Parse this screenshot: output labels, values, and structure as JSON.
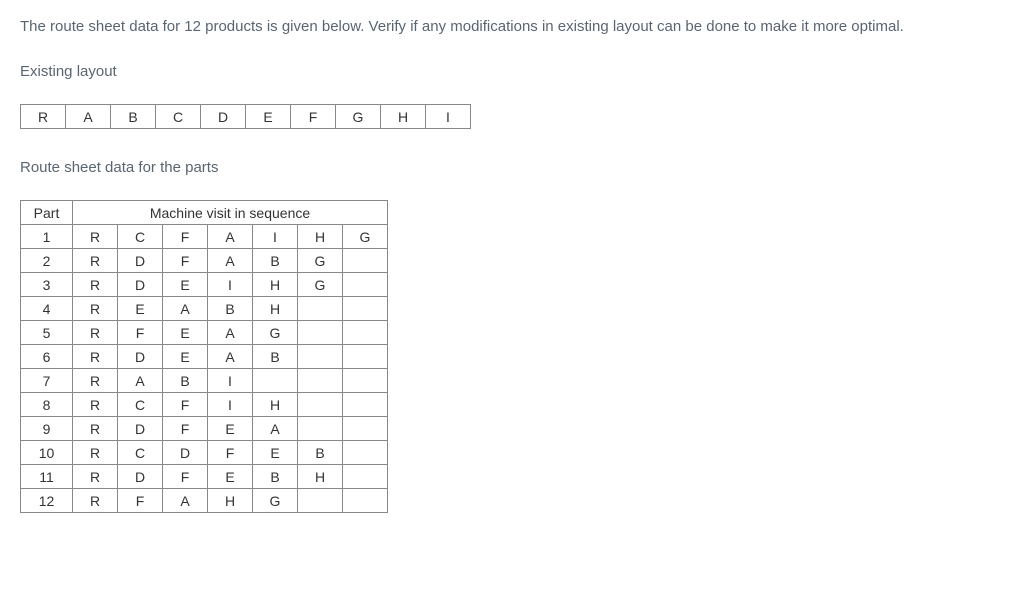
{
  "intro": "The route sheet data for 12 products is given below. Verify if any modifications in existing layout can be done to make it more optimal.",
  "existing_layout_label": "Existing layout",
  "existing_layout": [
    "R",
    "A",
    "B",
    "C",
    "D",
    "E",
    "F",
    "G",
    "H",
    "I"
  ],
  "route_sheet_label": "Route sheet data for the parts",
  "route_table": {
    "part_header": "Part",
    "sequence_header": "Machine visit in sequence",
    "num_sequence_cols": 7,
    "rows": [
      {
        "part": "1",
        "seq": [
          "R",
          "C",
          "F",
          "A",
          "I",
          "H",
          "G"
        ]
      },
      {
        "part": "2",
        "seq": [
          "R",
          "D",
          "F",
          "A",
          "B",
          "G",
          ""
        ]
      },
      {
        "part": "3",
        "seq": [
          "R",
          "D",
          "E",
          "I",
          "H",
          "G",
          ""
        ]
      },
      {
        "part": "4",
        "seq": [
          "R",
          "E",
          "A",
          "B",
          "H",
          "",
          ""
        ]
      },
      {
        "part": "5",
        "seq": [
          "R",
          "F",
          "E",
          "A",
          "G",
          "",
          ""
        ]
      },
      {
        "part": "6",
        "seq": [
          "R",
          "D",
          "E",
          "A",
          "B",
          "",
          ""
        ]
      },
      {
        "part": "7",
        "seq": [
          "R",
          "A",
          "B",
          "I",
          "",
          "",
          ""
        ]
      },
      {
        "part": "8",
        "seq": [
          "R",
          "C",
          "F",
          "I",
          "H",
          "",
          ""
        ]
      },
      {
        "part": "9",
        "seq": [
          "R",
          "D",
          "F",
          "E",
          "A",
          "",
          ""
        ]
      },
      {
        "part": "10",
        "seq": [
          "R",
          "C",
          "D",
          "F",
          "E",
          "B",
          ""
        ]
      },
      {
        "part": "11",
        "seq": [
          "R",
          "D",
          "F",
          "E",
          "B",
          "H",
          ""
        ]
      },
      {
        "part": "12",
        "seq": [
          "R",
          "F",
          "A",
          "H",
          "G",
          "",
          ""
        ]
      }
    ]
  }
}
